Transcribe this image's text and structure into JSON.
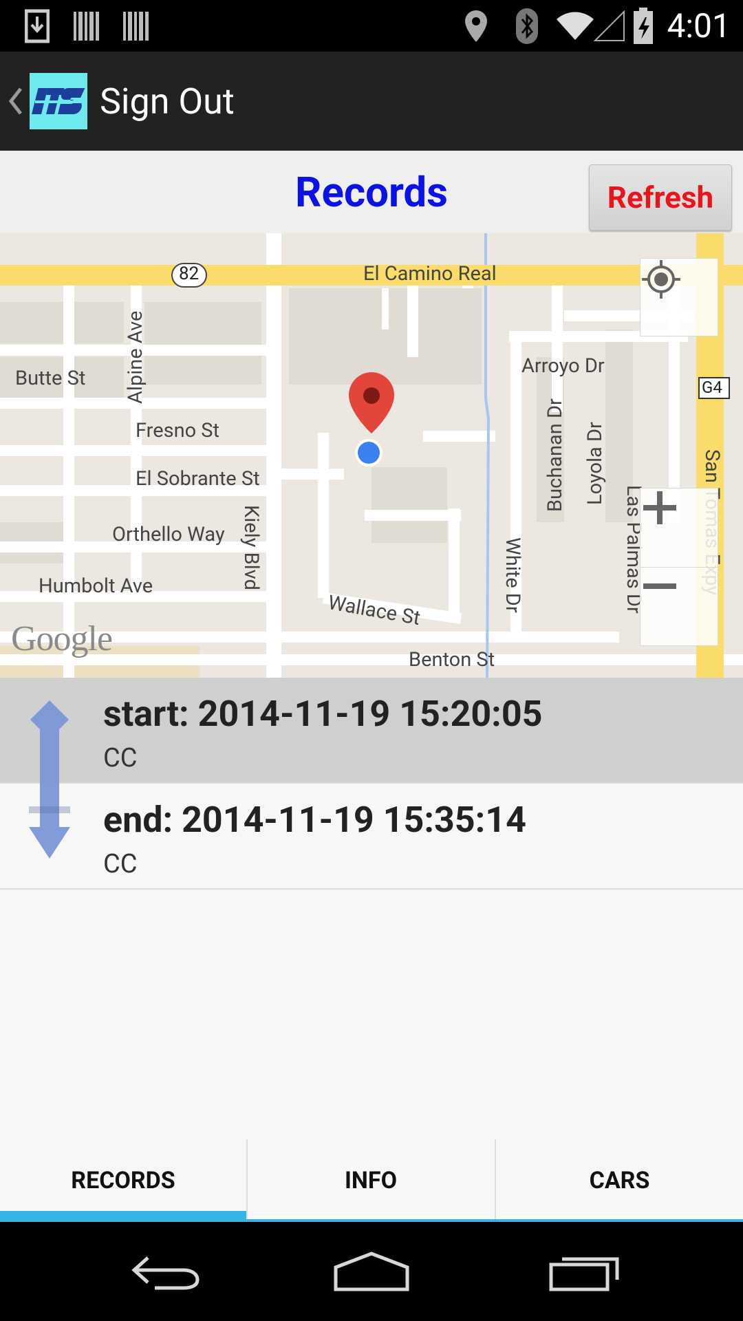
{
  "status_bar": {
    "time": "4:01",
    "icons": [
      "download-icon",
      "barcode-icon",
      "barcode-icon",
      "location-icon",
      "bluetooth-icon",
      "wifi-icon",
      "signal-icon",
      "battery-icon"
    ]
  },
  "action_bar": {
    "logo_text": "ITS",
    "title": "Sign Out"
  },
  "header": {
    "title": "Records",
    "refresh_label": "Refresh"
  },
  "map": {
    "labels": {
      "el_camino": "El Camino Real",
      "route_82": "82",
      "route_g4": "G4",
      "butte": "Butte St",
      "alpine": "Alpine Ave",
      "fresno": "Fresno St",
      "el_sobrante": "El Sobrante St",
      "orthello": "Orthello Way",
      "humbolt": "Humbolt Ave",
      "kiely": "Kiely Blvd",
      "wallace": "Wallace St",
      "benton": "Benton St",
      "arroyo": "Arroyo Dr",
      "buchanan": "Buchanan Dr",
      "loyola": "Loyola Dr",
      "white": "White Dr",
      "las_palmas": "Las Palmas Dr",
      "san_tomas": "San Tomas Expy"
    },
    "attribution": "Google",
    "colors": {
      "road": "#ffffff",
      "highway": "#f9dc6a",
      "pin": "#e2463b",
      "my_location": "#3b82f0"
    }
  },
  "records": [
    {
      "title": "start: 2014-11-19 15:20:05",
      "subtitle": "CC"
    },
    {
      "title": "end: 2014-11-19 15:35:14",
      "subtitle": "CC"
    }
  ],
  "tabs": [
    {
      "label": "RECORDS",
      "active": true
    },
    {
      "label": "INFO",
      "active": false
    },
    {
      "label": "CARS",
      "active": false
    }
  ],
  "accent_color": "#33b5e5"
}
